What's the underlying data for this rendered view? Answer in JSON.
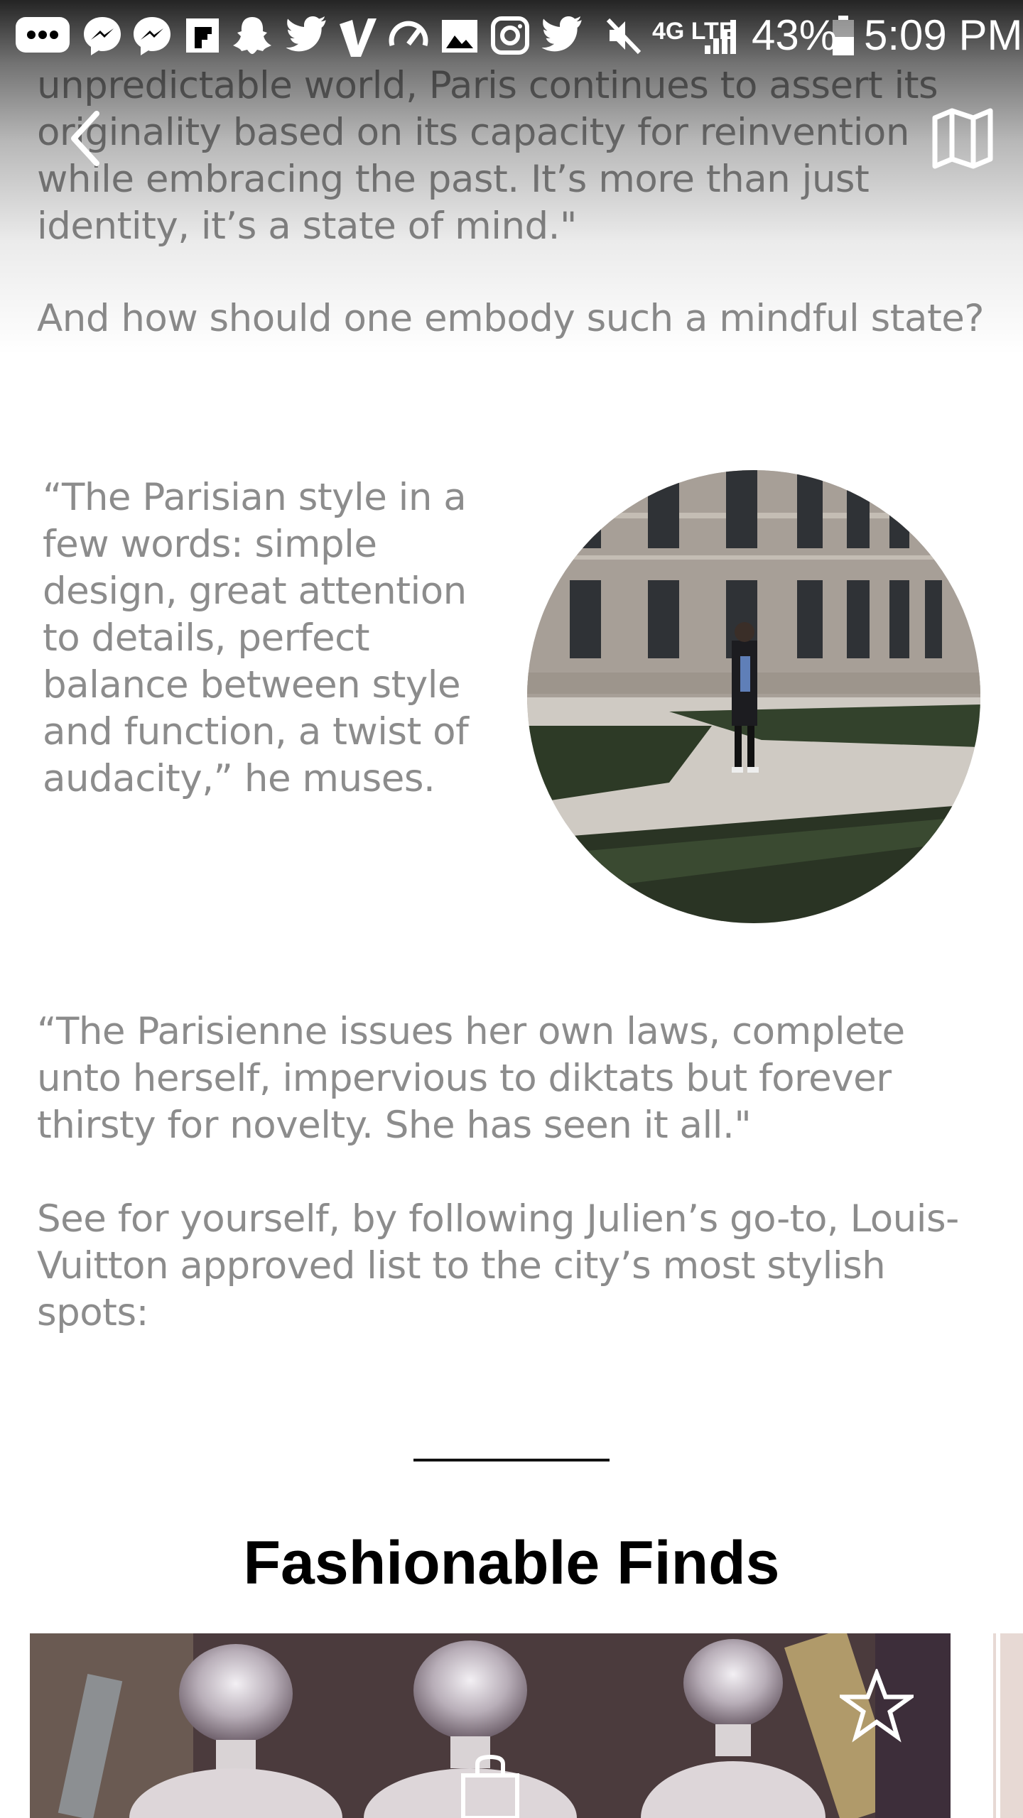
{
  "status_bar": {
    "battery_percent": "43%",
    "time": "5:09 PM",
    "network": "4G LTE",
    "icons": [
      "messages-icon",
      "messenger-icon",
      "messenger-icon",
      "flipboard-icon",
      "snapchat-icon",
      "twitter-icon",
      "vimeo-icon",
      "speedometer-icon",
      "gallery-icon",
      "instagram-icon",
      "twitter-icon",
      "mute-icon",
      "network-4g-icon",
      "signal-icon",
      "battery-icon"
    ]
  },
  "nav": {
    "back_icon": "chevron-left-icon",
    "map_icon": "map-icon"
  },
  "article": {
    "intro": "unpredictable world, Paris continues to assert its originality based on its capacity for reinvention while embracing the past. It’s more than just identity, it’s a state of mind.\"",
    "question": "And how should one embody such a mindful state?",
    "quote1": "“The Parisian style in a few words: simple design, great attention to details, perfect balance between style and function, a twist of audacity,” he muses.",
    "quote2": "“The Parisienne issues her own laws, complete unto herself, impervious to diktats but forever thirsty for novelty. She has seen it all.\"",
    "follow": "See for yourself, by following Julien’s go-to, Louis-Vuitton approved list to the city’s most stylish spots:"
  },
  "section": {
    "title": "Fashionable Finds"
  },
  "card": {
    "favorite_icon": "star-outline-icon",
    "category_icon": "shopping-bag-icon"
  },
  "colors": {
    "body_text": "#8c8c8c",
    "title": "#000000",
    "divider": "#111111"
  }
}
